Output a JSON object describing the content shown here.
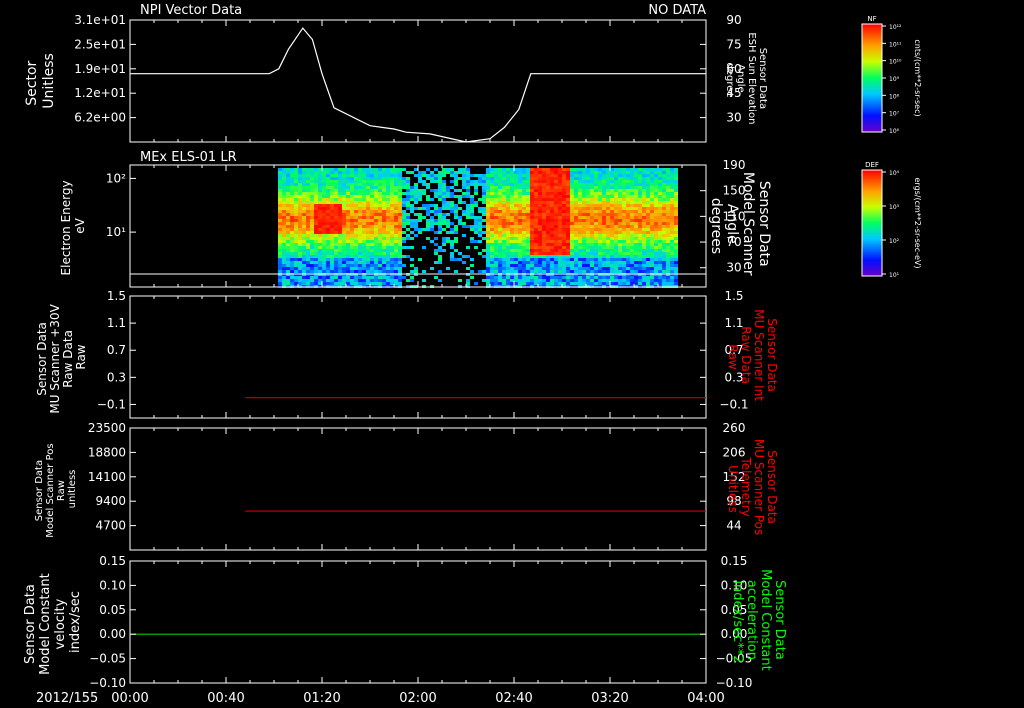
{
  "chart_data": [
    {
      "type": "line",
      "title": "NPI Vector Data",
      "status": "NO DATA",
      "ylabel": [
        "Sector",
        "Unitless"
      ],
      "ytick_labels": [
        "3.1e+01",
        "2.5e+01",
        "1.9e+01",
        "1.2e+01",
        "6.2e+00"
      ],
      "right_ylabel": [
        "Sensor Data",
        "ESH Sun Elevation",
        "Angle",
        "degree"
      ],
      "right_ylim": [
        15,
        90
      ],
      "right_yticks": [
        90,
        75,
        60,
        45,
        30
      ],
      "series": [
        {
          "x": [
            0,
            50,
            58,
            62,
            66,
            72,
            76,
            80,
            85,
            100,
            110,
            115,
            125,
            140,
            150,
            156,
            162,
            167,
            240
          ],
          "y": [
            57,
            57,
            57,
            60,
            72,
            85,
            78,
            57,
            36,
            25,
            23,
            21,
            20,
            15,
            17,
            24,
            35,
            57,
            57
          ],
          "color": "#ffffff"
        }
      ]
    },
    {
      "type": "heatmap",
      "title": "MEx ELS-01 LR",
      "ylabel": [
        "Electron Energy",
        "eV"
      ],
      "ytick_labels": [
        "10²",
        "10¹"
      ],
      "right_ylabel": [
        "Sensor Data",
        "Model Scanner",
        "Angle",
        "degrees"
      ],
      "right_ylim": [
        0,
        190
      ],
      "right_yticks": [
        190,
        150,
        110,
        70,
        30
      ],
      "colorbar_label": "DEF",
      "colorbar_units": "ergs/(cm**2-sr-sec-eV)",
      "colorbar_ticks": [
        "10⁴",
        "10³",
        "10²",
        "10¹"
      ]
    },
    {
      "type": "line",
      "ylabel": [
        "Sensor Data",
        "MU Scanner +30V",
        "Raw Data",
        "Raw"
      ],
      "ylim": [
        -0.3,
        1.5
      ],
      "yticks": [
        1.5,
        1.1,
        0.7,
        0.3,
        -0.1
      ],
      "right_ylabel": [
        "Sensor Data",
        "MU Scanner Int",
        "Raw Data",
        "Raw"
      ],
      "right_yticks": [
        1.5,
        1.1,
        0.7,
        0.3,
        -0.1
      ],
      "series": [
        {
          "x": [
            48,
            240
          ],
          "y": [
            0.0,
            0.0
          ],
          "color": "#cc0000"
        }
      ]
    },
    {
      "type": "line",
      "ylabel": [
        "Sensor Data",
        "Model Scanner Pos",
        "Raw",
        "unitless"
      ],
      "ylim": [
        0,
        23500
      ],
      "yticks": [
        23500,
        18800,
        14100,
        9400,
        4700
      ],
      "right_ylabel": [
        "Sensor Data",
        "MU Scanner Pos",
        "Telemetry",
        "Unitless"
      ],
      "right_yticks": [
        260,
        206,
        152,
        98,
        44
      ],
      "series": [
        {
          "x": [
            48,
            240
          ],
          "y": [
            7500,
            7500
          ],
          "color": "#cc0000"
        }
      ]
    },
    {
      "type": "line",
      "ylabel": [
        "Sensor Data",
        "Model Constant",
        "velocity",
        "index/sec"
      ],
      "ylim": [
        -0.1,
        0.15
      ],
      "yticks": [
        0.15,
        0.1,
        0.05,
        0.0,
        -0.05,
        -0.1
      ],
      "ytick_labels": [
        "0.15",
        "0.10",
        "0.05",
        "0.00",
        "−0.05",
        "−0.10"
      ],
      "right_ylabel": [
        "Sensor Data",
        "Model Constant",
        "acceleration",
        "index/sec**2"
      ],
      "right_ytick_labels": [
        "0.15",
        "0.10",
        "0.05",
        "0.00",
        "−0.05",
        "−0.10"
      ],
      "series": [
        {
          "x": [
            0,
            240
          ],
          "y": [
            0.0,
            0.0
          ],
          "color": "#00cc00"
        }
      ]
    }
  ],
  "x_axis": {
    "date_label": "2012/155",
    "xlim": [
      0,
      240
    ],
    "tick_labels": [
      "00:00",
      "00:40",
      "01:20",
      "02:00",
      "02:40",
      "03:20",
      "04:00"
    ]
  },
  "colorbar_nf": {
    "label": "NF",
    "units": "cnts/(cm**2-sr-sec)",
    "ticks": [
      "10¹²",
      "10¹¹",
      "10¹⁰",
      "10⁹",
      "10⁸",
      "10⁷",
      "10⁶"
    ]
  },
  "colors": {
    "background": "#000000",
    "axis": "#ffffff",
    "red_label": "#ff0000",
    "green_label": "#00ff00"
  }
}
